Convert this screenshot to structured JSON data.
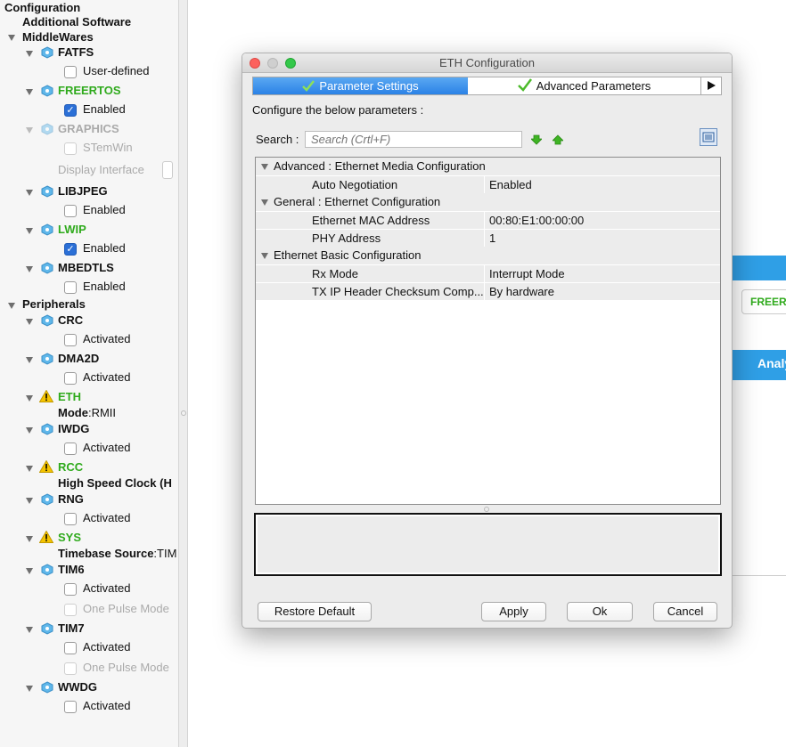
{
  "tree": {
    "title": "Configuration",
    "additional_software": "Additional Software",
    "middlewares": "MiddleWares",
    "fatfs": "FATFS",
    "user_defined": "User-defined",
    "freertos": "FREERTOS",
    "freertos_enabled": "Enabled",
    "graphics": "GRAPHICS",
    "stemwin": "STemWin",
    "display_interface": "Display Interface",
    "libjpeg": "LIBJPEG",
    "libjpeg_enabled": "Enabled",
    "lwip": "LWIP",
    "lwip_enabled": "Enabled",
    "mbedtls": "MBEDTLS",
    "mbedtls_enabled": "Enabled",
    "peripherals": "Peripherals",
    "crc": "CRC",
    "crc_activated": "Activated",
    "dma2d": "DMA2D",
    "dma2d_activated": "Activated",
    "eth": "ETH",
    "eth_mode_label": "Mode",
    "eth_mode_value": ":RMII",
    "iwdg": "IWDG",
    "iwdg_activated": "Activated",
    "rcc": "RCC",
    "rcc_hse": "High Speed Clock (H",
    "rng": "RNG",
    "rng_activated": "Activated",
    "sys": "SYS",
    "sys_timebase_label": "Timebase Source",
    "sys_timebase_value": ":TIM",
    "tim6": "TIM6",
    "tim6_activated": "Activated",
    "tim6_one_pulse": "One Pulse Mode",
    "tim7": "TIM7",
    "tim7_activated": "Activated",
    "tim7_one_pulse": "One Pulse Mode",
    "wwdg": "WWDG",
    "wwdg_activated": "Activated"
  },
  "background": {
    "freertos_button": "FREERTOS",
    "analyze_button": "Analyze"
  },
  "dialog": {
    "title": "ETH Configuration",
    "tab_parameter_settings": "Parameter Settings",
    "tab_advanced_parameters": "Advanced Parameters",
    "hint": "Configure the below parameters :",
    "search_label": "Search :",
    "search_placeholder": "Search (Crtl+F)",
    "sections": {
      "advanced": "Advanced : Ethernet Media Configuration",
      "general": "General : Ethernet Configuration",
      "basic": "Ethernet Basic Configuration"
    },
    "params": {
      "auto_negotiation": {
        "name": "Auto Negotiation",
        "value": "Enabled"
      },
      "mac_address": {
        "name": "Ethernet MAC Address",
        "value": "00:80:E1:00:00:00"
      },
      "phy_address": {
        "name": "PHY Address",
        "value": "1"
      },
      "rx_mode": {
        "name": "Rx Mode",
        "value": "Interrupt Mode"
      },
      "tx_checksum": {
        "name": "TX IP Header Checksum Comp...",
        "value": "By hardware"
      }
    },
    "buttons": {
      "restore_default": "Restore Default",
      "apply": "Apply",
      "ok": "Ok",
      "cancel": "Cancel"
    }
  },
  "colors": {
    "enabled_green": "#2faa1c",
    "selected_tab_blue": "#2b82e6",
    "close_red": "#fc615d",
    "minimize_gray": "#cfcfcf",
    "zoom_green": "#34c84a"
  }
}
